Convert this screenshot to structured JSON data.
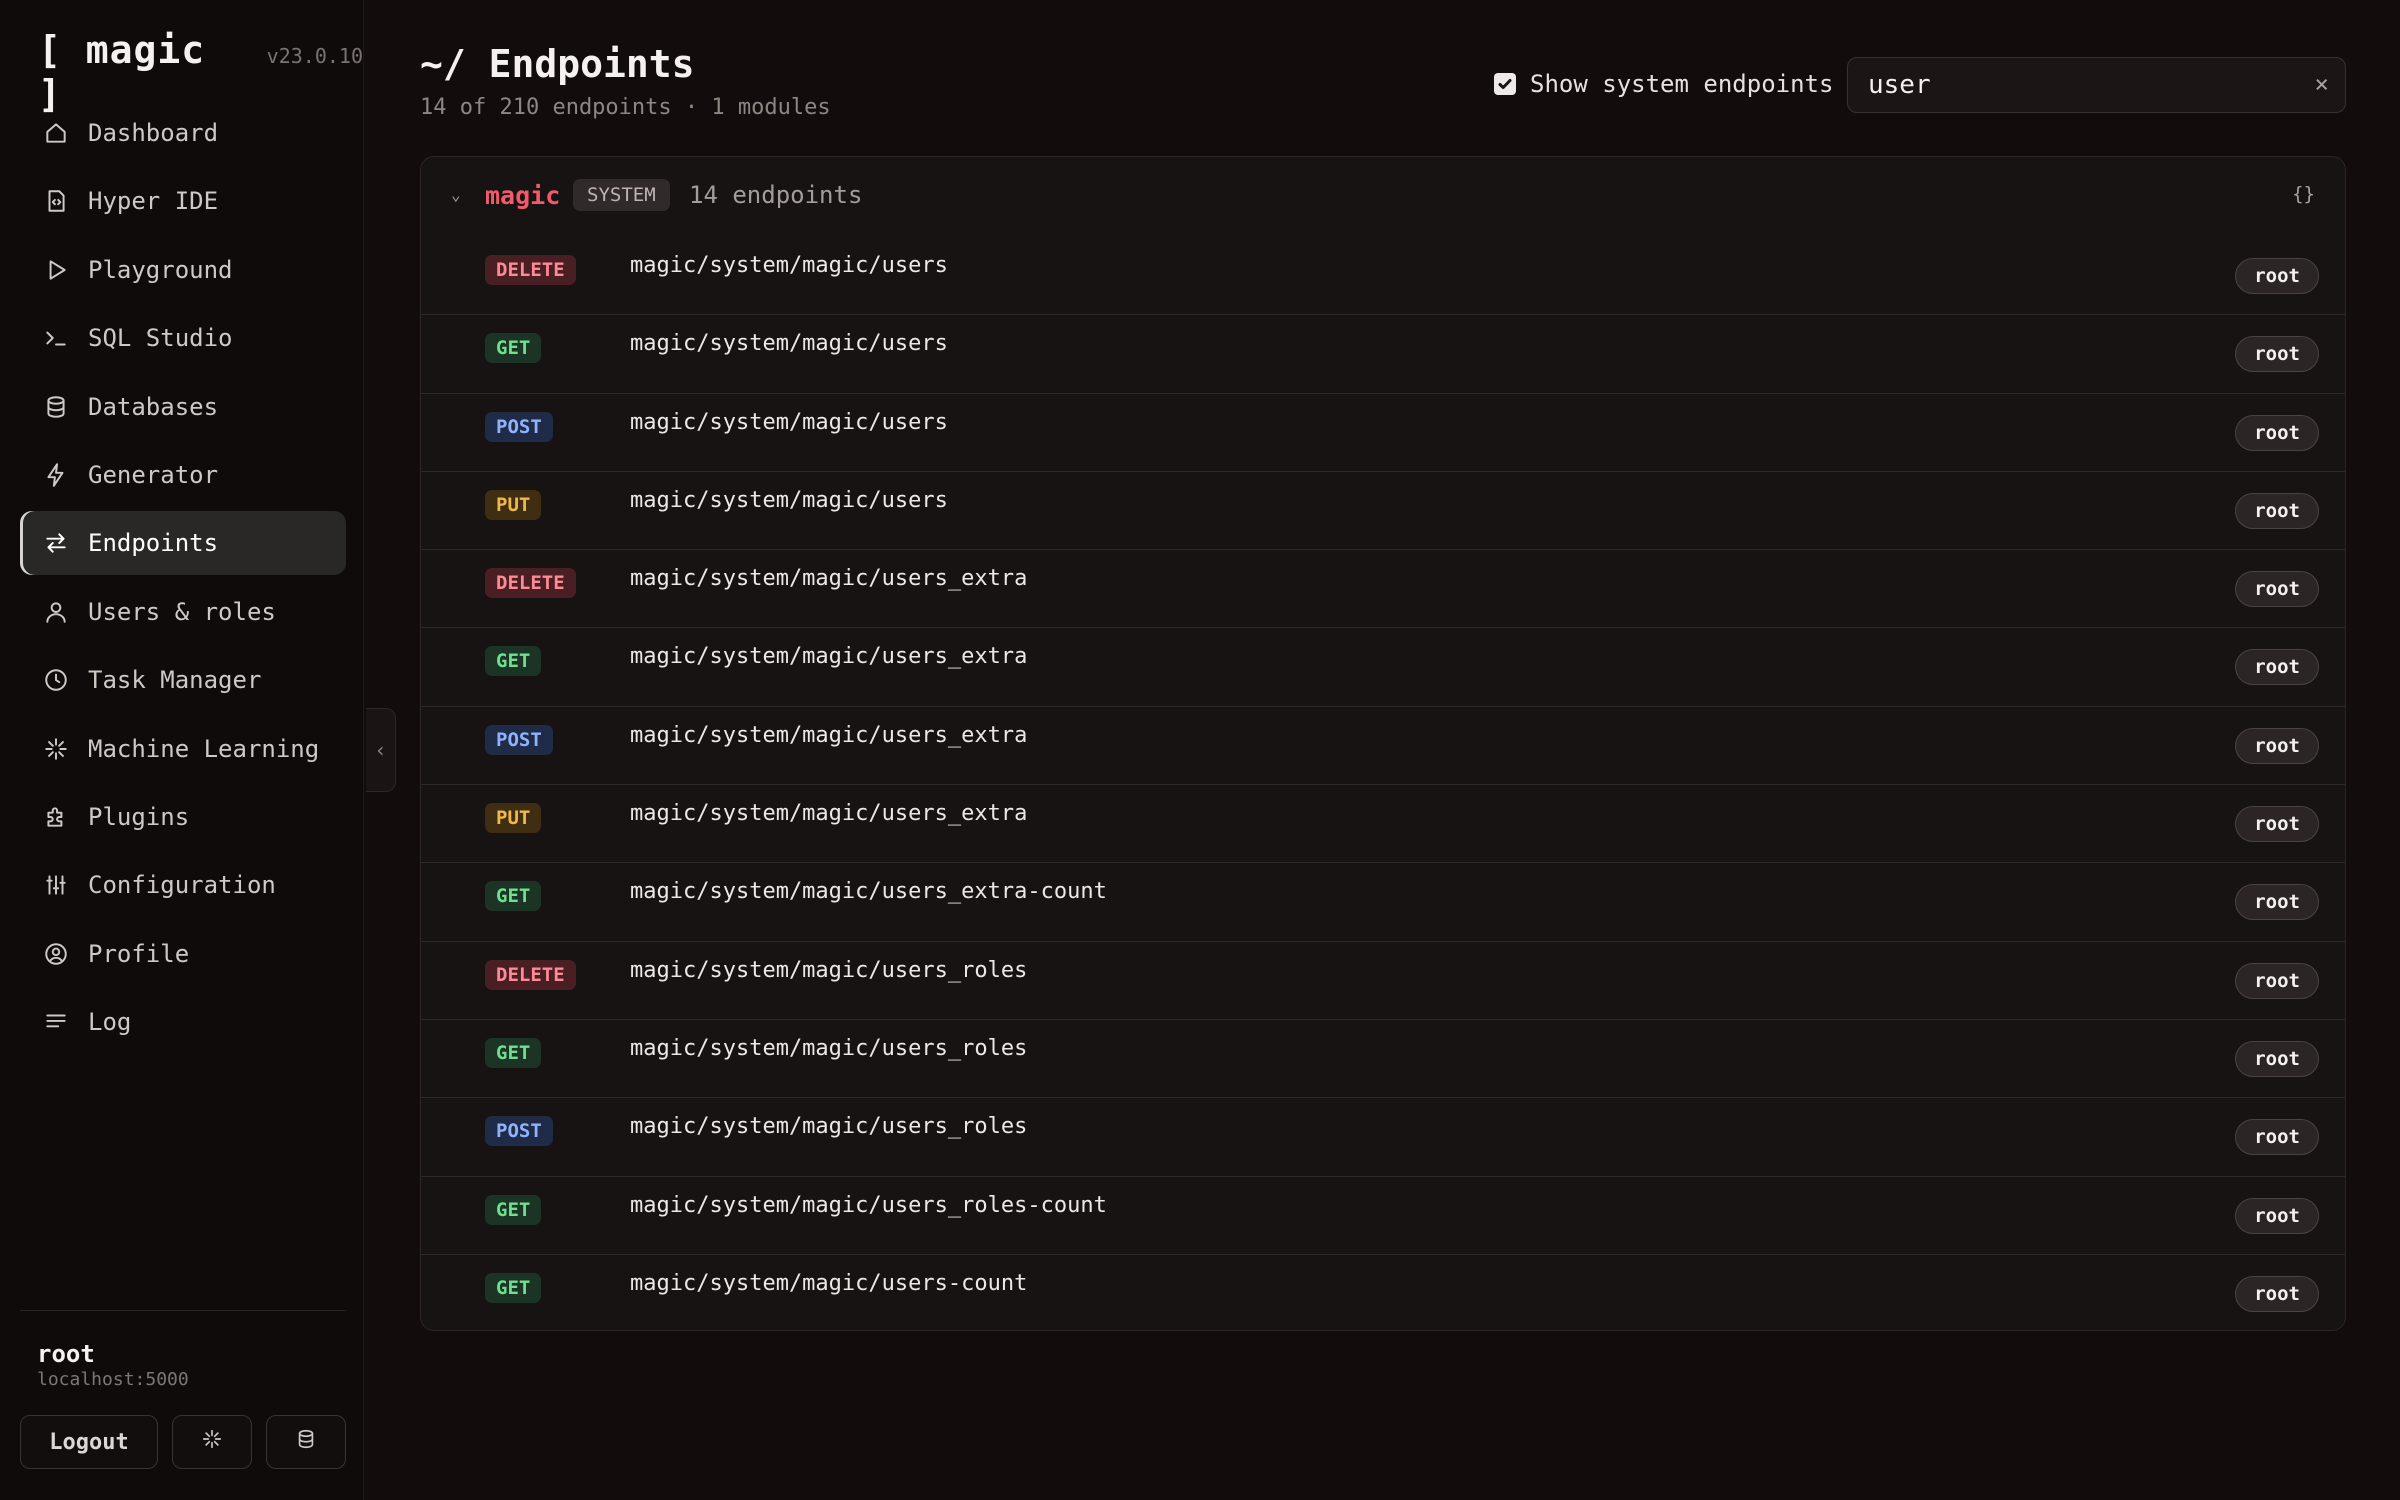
{
  "app": {
    "name": "[ magic ]",
    "version": "v23.0.10"
  },
  "sidebar": {
    "items": [
      {
        "label": "Dashboard",
        "icon": "home-icon"
      },
      {
        "label": "Hyper IDE",
        "icon": "code-file-icon"
      },
      {
        "label": "Playground",
        "icon": "play-icon"
      },
      {
        "label": "SQL Studio",
        "icon": "terminal-icon"
      },
      {
        "label": "Databases",
        "icon": "database-icon"
      },
      {
        "label": "Generator",
        "icon": "lightning-icon"
      },
      {
        "label": "Endpoints",
        "icon": "arrows-icon",
        "active": true
      },
      {
        "label": "Users & roles",
        "icon": "user-icon"
      },
      {
        "label": "Task Manager",
        "icon": "clock-icon"
      },
      {
        "label": "Machine Learning",
        "icon": "sparkle-icon"
      },
      {
        "label": "Plugins",
        "icon": "puzzle-icon"
      },
      {
        "label": "Configuration",
        "icon": "sliders-icon"
      },
      {
        "label": "Profile",
        "icon": "user-circle-icon"
      },
      {
        "label": "Log",
        "icon": "lines-icon"
      }
    ],
    "user": {
      "name": "root",
      "host": "localhost:5000"
    },
    "logout_label": "Logout"
  },
  "header": {
    "title": "~/ Endpoints",
    "subtitle": "14 of 210 endpoints · 1 modules",
    "show_system_label": "Show system endpoints",
    "show_system_checked": true,
    "search_value": "user",
    "clear_symbol": "×"
  },
  "module": {
    "name": "magic",
    "badge": "SYSTEM",
    "count_label": "14 endpoints",
    "json_icon_label": "{}",
    "endpoints": [
      {
        "method": "DELETE",
        "path": "magic/system/magic/users",
        "role": "root"
      },
      {
        "method": "GET",
        "path": "magic/system/magic/users",
        "role": "root"
      },
      {
        "method": "POST",
        "path": "magic/system/magic/users",
        "role": "root"
      },
      {
        "method": "PUT",
        "path": "magic/system/magic/users",
        "role": "root"
      },
      {
        "method": "DELETE",
        "path": "magic/system/magic/users_extra",
        "role": "root"
      },
      {
        "method": "GET",
        "path": "magic/system/magic/users_extra",
        "role": "root"
      },
      {
        "method": "POST",
        "path": "magic/system/magic/users_extra",
        "role": "root"
      },
      {
        "method": "PUT",
        "path": "magic/system/magic/users_extra",
        "role": "root"
      },
      {
        "method": "GET",
        "path": "magic/system/magic/users_extra-count",
        "role": "root"
      },
      {
        "method": "DELETE",
        "path": "magic/system/magic/users_roles",
        "role": "root"
      },
      {
        "method": "GET",
        "path": "magic/system/magic/users_roles",
        "role": "root"
      },
      {
        "method": "POST",
        "path": "magic/system/magic/users_roles",
        "role": "root"
      },
      {
        "method": "GET",
        "path": "magic/system/magic/users_roles-count",
        "role": "root"
      },
      {
        "method": "GET",
        "path": "magic/system/magic/users-count",
        "role": "root"
      }
    ]
  },
  "colors": {
    "module_accent": "#f05a6a",
    "delete": "#ff8a95",
    "get": "#6fe08e",
    "post": "#8fb4ff",
    "put": "#f1b94a"
  }
}
